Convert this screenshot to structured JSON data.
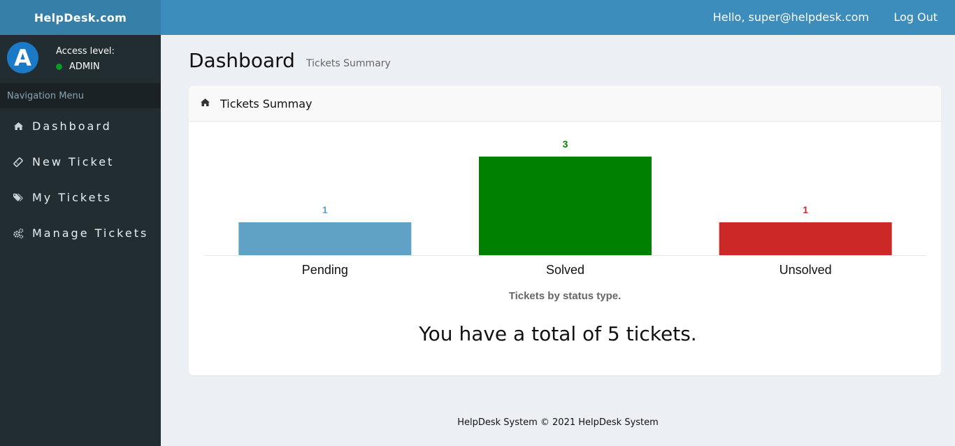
{
  "brand": {
    "title": "HelpDesk.com"
  },
  "user_panel": {
    "avatar_letter": "A",
    "access_label": "Access level:",
    "access_value": "ADMIN"
  },
  "nav": {
    "header": "Navigation Menu",
    "items": [
      {
        "label": "Dashboard",
        "icon": "home-icon"
      },
      {
        "label": "New Ticket",
        "icon": "ticket-icon"
      },
      {
        "label": "My Tickets",
        "icon": "tags-icon"
      },
      {
        "label": "Manage Tickets",
        "icon": "cogs-icon"
      }
    ]
  },
  "topbar": {
    "greeting": "Hello, super@helpdesk.com",
    "logout": "Log Out"
  },
  "page": {
    "title": "Dashboard",
    "subtitle": "Tickets Summary"
  },
  "box": {
    "title": "Tickets Summay"
  },
  "colors": {
    "pending": "#5fa2c5",
    "solved": "#008000",
    "unsolved": "#cc2828"
  },
  "chart_data": {
    "type": "bar",
    "categories": [
      "Pending",
      "Solved",
      "Unsolved"
    ],
    "values": [
      1,
      3,
      1
    ],
    "colors": [
      "#5fa2c5",
      "#008000",
      "#cc2828"
    ],
    "caption": "Tickets by status type.",
    "grid": false
  },
  "summary": {
    "total_text": "You have a total of 5 tickets."
  },
  "footer": {
    "text": "HelpDesk System © 2021 HelpDesk System"
  }
}
